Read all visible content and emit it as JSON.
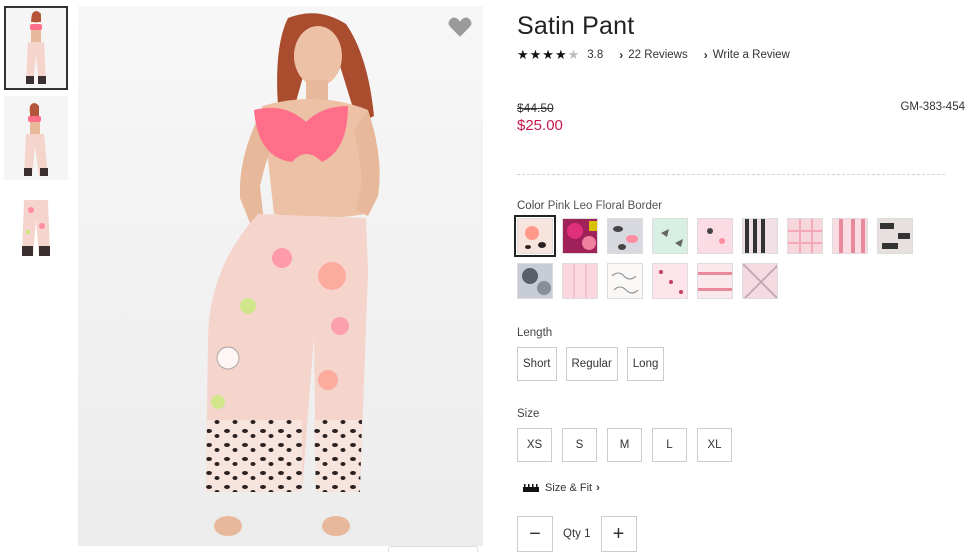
{
  "product": {
    "title": "Satin Pant",
    "rating": {
      "stars": "★★★★",
      "empty_star": "★",
      "value": "3.8"
    },
    "reviews_link": "22 Reviews",
    "write_review_link": "Write a Review",
    "price_original": "$44.50",
    "price_sale": "$25.00",
    "sku": "GM-383-454"
  },
  "color": {
    "label": "Color",
    "selected": "Pink Leo Floral Border",
    "swatch_count": 15
  },
  "length": {
    "label": "Length",
    "options": [
      "Short",
      "Regular",
      "Long"
    ]
  },
  "size": {
    "label": "Size",
    "options": [
      "XS",
      "S",
      "M",
      "L",
      "XL"
    ]
  },
  "size_fit": {
    "label": "Size & Fit",
    "chevron": "›"
  },
  "quantity": {
    "minus": "−",
    "plus": "+",
    "label": "Qty",
    "value": "1"
  },
  "icons": {
    "favorite": "heart-icon",
    "size_fit": "ruler-icon",
    "chevron": "chevron-right-icon"
  },
  "colors": {
    "sale_price": "#c8174b",
    "heart": "#9a9a9a",
    "bra": "#ff6f8a",
    "pant": "#f5d4cc"
  }
}
